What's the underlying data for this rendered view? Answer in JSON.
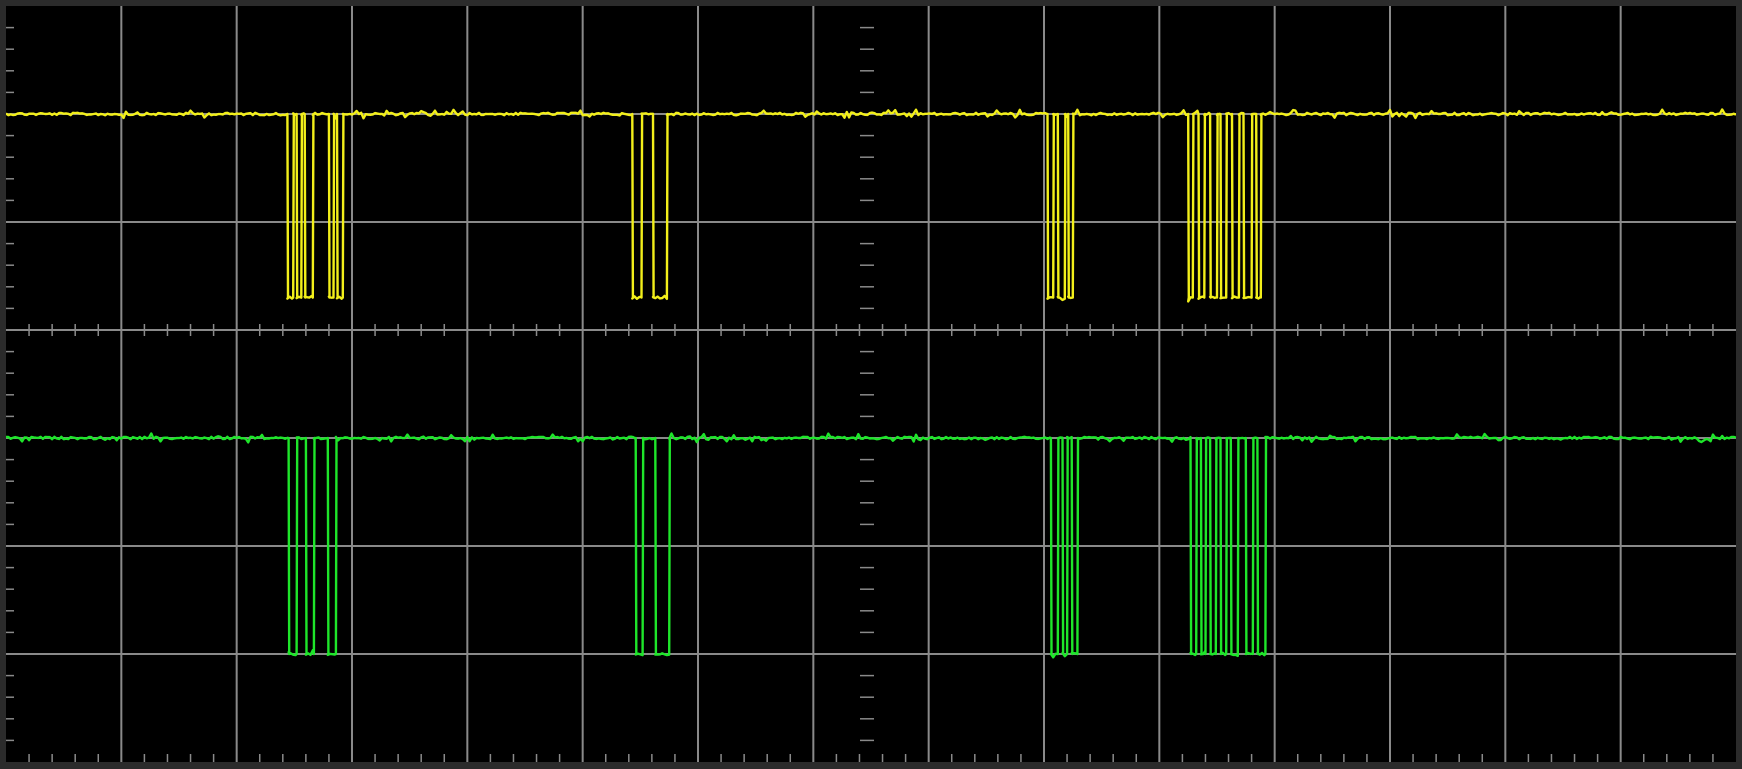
{
  "scope": {
    "divisions": {
      "horizontal": 15,
      "vertical": 7,
      "minor_per_division": 5
    },
    "colors": {
      "background": "#000000",
      "frame": "#2b2b2b",
      "grid": "#8a8a8a",
      "channel_1": "#f2ef1a",
      "channel_2": "#1ee62a"
    },
    "time_range": [
      0,
      15
    ],
    "channels": [
      {
        "id": "ch1",
        "high_level": 6.0,
        "low_level": 4.3,
        "transitions": [
          2.44,
          2.49,
          2.52,
          2.56,
          2.59,
          2.66,
          2.8,
          2.84,
          2.87,
          2.92,
          5.43,
          5.51,
          5.61,
          5.73,
          9.03,
          9.08,
          9.12,
          9.18,
          9.21,
          9.25,
          10.25,
          10.29,
          10.34,
          10.39,
          10.44,
          10.5,
          10.53,
          10.58,
          10.63,
          10.69,
          10.73,
          10.8,
          10.84,
          10.88
        ]
      },
      {
        "id": "ch2",
        "high_level": 3.0,
        "low_level": 1.0,
        "transitions": [
          2.45,
          2.52,
          2.6,
          2.67,
          2.79,
          2.86,
          5.46,
          5.52,
          5.63,
          5.75,
          9.06,
          9.12,
          9.16,
          9.2,
          9.24,
          9.29,
          10.27,
          10.32,
          10.36,
          10.4,
          10.44,
          10.49,
          10.53,
          10.58,
          10.62,
          10.68,
          10.75,
          10.81,
          10.85,
          10.92
        ]
      }
    ]
  }
}
